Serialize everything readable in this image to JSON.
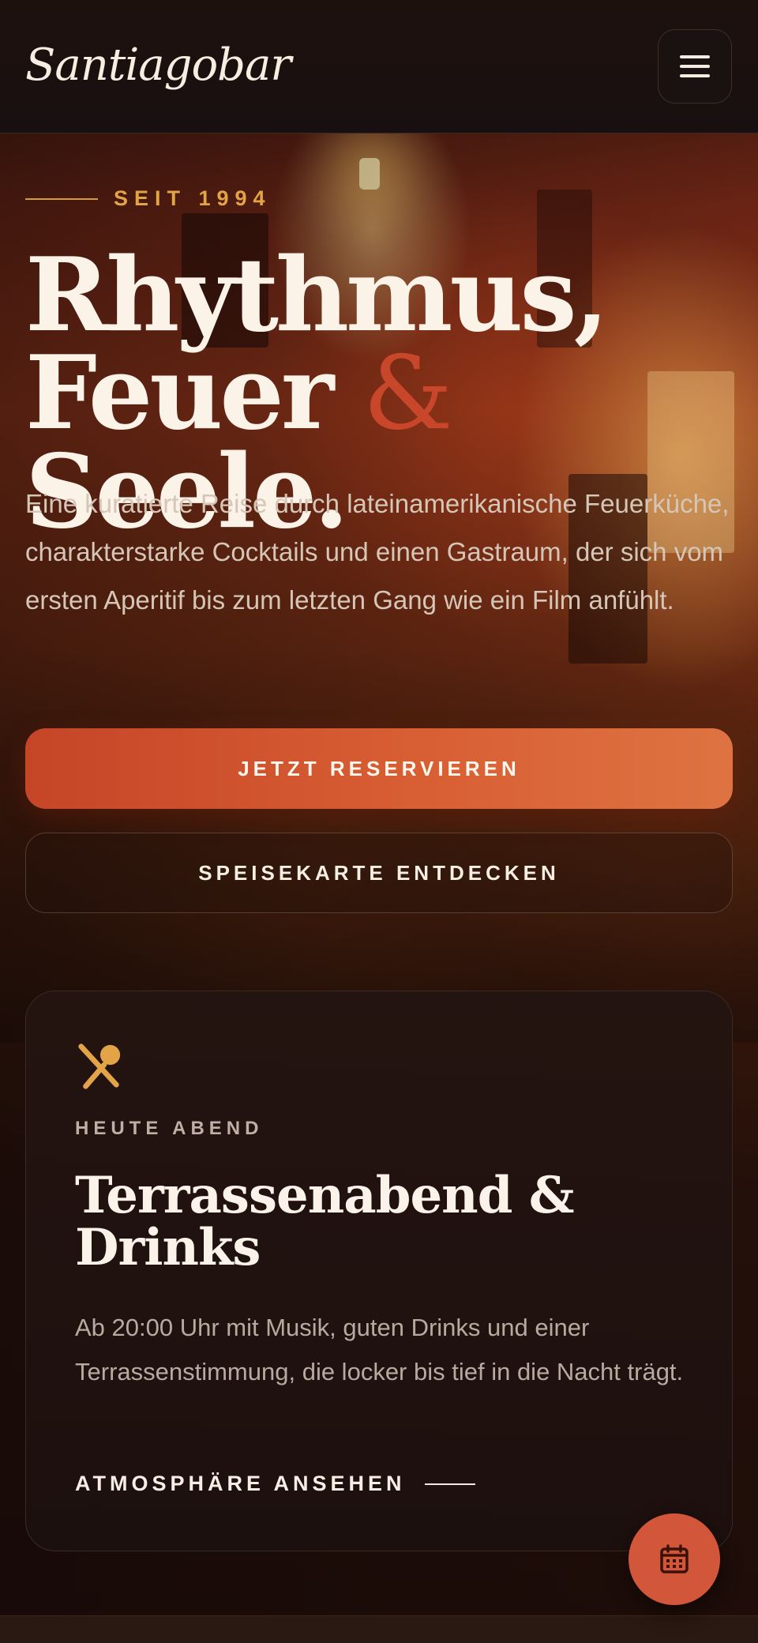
{
  "header": {
    "brand": "Santiagobar",
    "menu_icon": "hamburger-menu-icon"
  },
  "hero": {
    "eyebrow": "SEIT 1994",
    "headline_line1": "Rhythmus,",
    "headline_word1": "Feuer",
    "headline_amp": "&",
    "headline_word2": "Seele.",
    "intro": "Eine kuratierte Reise durch lateinamerikanische Feuerküche, charakterstarke Cocktails und einen Gastraum, der sich vom ersten Aperitif bis zum letzten Gang wie ein Film anfühlt.",
    "primary_cta": "JETZT RESERVIEREN",
    "secondary_cta": "SPEISEKARTE ENTDECKEN"
  },
  "event_card": {
    "icon": "utensils-icon",
    "kicker": "HEUTE ABEND",
    "title": "Terrassenabend & Drinks",
    "text": "Ab 20:00 Uhr mit Musik, guten Drinks und einer Terrassenstimmung, die locker bis tief in die Nacht trägt.",
    "link": "ATMOSPHÄRE ANSEHEN"
  },
  "fab": {
    "icon": "calendar-icon"
  },
  "colors": {
    "accent": "#d2573a",
    "gold": "#e3a448",
    "background": "#140c0a"
  }
}
